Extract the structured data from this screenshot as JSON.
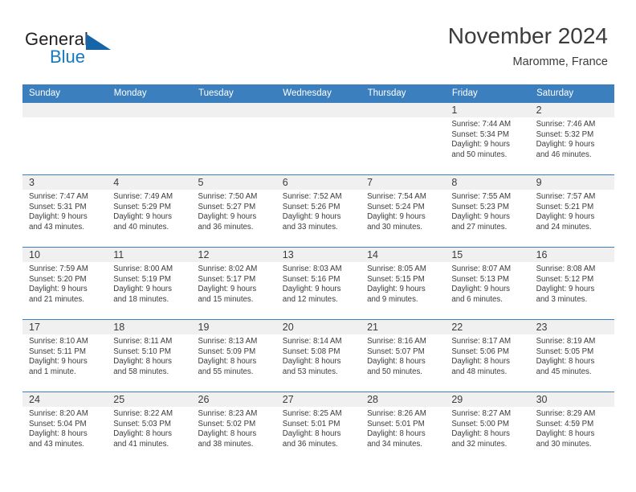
{
  "brand": {
    "word_one": "General",
    "word_two": "Blue",
    "triangle_icon": "triangle-logo-icon",
    "color_text": "#231f20",
    "color_blue": "#1878be"
  },
  "header": {
    "title": "November 2024",
    "subtitle": "Maromme, France"
  },
  "theme": {
    "header_blue": "#3c7fbe",
    "daynum_gray": "#f0f0f0",
    "text": "#3b3b3b"
  },
  "weekday_headers": [
    "Sunday",
    "Monday",
    "Tuesday",
    "Wednesday",
    "Thursday",
    "Friday",
    "Saturday"
  ],
  "labels": {
    "sunrise": "Sunrise:",
    "sunset": "Sunset:",
    "daylight": "Daylight:"
  },
  "weeks": [
    [
      {
        "day": "",
        "empty": true
      },
      {
        "day": "",
        "empty": true
      },
      {
        "day": "",
        "empty": true
      },
      {
        "day": "",
        "empty": true
      },
      {
        "day": "",
        "empty": true
      },
      {
        "day": "1",
        "sunrise": "Sunrise: 7:44 AM",
        "sunset": "Sunset: 5:34 PM",
        "daylight": "Daylight: 9 hours and 50 minutes."
      },
      {
        "day": "2",
        "sunrise": "Sunrise: 7:46 AM",
        "sunset": "Sunset: 5:32 PM",
        "daylight": "Daylight: 9 hours and 46 minutes."
      }
    ],
    [
      {
        "day": "3",
        "sunrise": "Sunrise: 7:47 AM",
        "sunset": "Sunset: 5:31 PM",
        "daylight": "Daylight: 9 hours and 43 minutes."
      },
      {
        "day": "4",
        "sunrise": "Sunrise: 7:49 AM",
        "sunset": "Sunset: 5:29 PM",
        "daylight": "Daylight: 9 hours and 40 minutes."
      },
      {
        "day": "5",
        "sunrise": "Sunrise: 7:50 AM",
        "sunset": "Sunset: 5:27 PM",
        "daylight": "Daylight: 9 hours and 36 minutes."
      },
      {
        "day": "6",
        "sunrise": "Sunrise: 7:52 AM",
        "sunset": "Sunset: 5:26 PM",
        "daylight": "Daylight: 9 hours and 33 minutes."
      },
      {
        "day": "7",
        "sunrise": "Sunrise: 7:54 AM",
        "sunset": "Sunset: 5:24 PM",
        "daylight": "Daylight: 9 hours and 30 minutes."
      },
      {
        "day": "8",
        "sunrise": "Sunrise: 7:55 AM",
        "sunset": "Sunset: 5:23 PM",
        "daylight": "Daylight: 9 hours and 27 minutes."
      },
      {
        "day": "9",
        "sunrise": "Sunrise: 7:57 AM",
        "sunset": "Sunset: 5:21 PM",
        "daylight": "Daylight: 9 hours and 24 minutes."
      }
    ],
    [
      {
        "day": "10",
        "sunrise": "Sunrise: 7:59 AM",
        "sunset": "Sunset: 5:20 PM",
        "daylight": "Daylight: 9 hours and 21 minutes."
      },
      {
        "day": "11",
        "sunrise": "Sunrise: 8:00 AM",
        "sunset": "Sunset: 5:19 PM",
        "daylight": "Daylight: 9 hours and 18 minutes."
      },
      {
        "day": "12",
        "sunrise": "Sunrise: 8:02 AM",
        "sunset": "Sunset: 5:17 PM",
        "daylight": "Daylight: 9 hours and 15 minutes."
      },
      {
        "day": "13",
        "sunrise": "Sunrise: 8:03 AM",
        "sunset": "Sunset: 5:16 PM",
        "daylight": "Daylight: 9 hours and 12 minutes."
      },
      {
        "day": "14",
        "sunrise": "Sunrise: 8:05 AM",
        "sunset": "Sunset: 5:15 PM",
        "daylight": "Daylight: 9 hours and 9 minutes."
      },
      {
        "day": "15",
        "sunrise": "Sunrise: 8:07 AM",
        "sunset": "Sunset: 5:13 PM",
        "daylight": "Daylight: 9 hours and 6 minutes."
      },
      {
        "day": "16",
        "sunrise": "Sunrise: 8:08 AM",
        "sunset": "Sunset: 5:12 PM",
        "daylight": "Daylight: 9 hours and 3 minutes."
      }
    ],
    [
      {
        "day": "17",
        "sunrise": "Sunrise: 8:10 AM",
        "sunset": "Sunset: 5:11 PM",
        "daylight": "Daylight: 9 hours and 1 minute."
      },
      {
        "day": "18",
        "sunrise": "Sunrise: 8:11 AM",
        "sunset": "Sunset: 5:10 PM",
        "daylight": "Daylight: 8 hours and 58 minutes."
      },
      {
        "day": "19",
        "sunrise": "Sunrise: 8:13 AM",
        "sunset": "Sunset: 5:09 PM",
        "daylight": "Daylight: 8 hours and 55 minutes."
      },
      {
        "day": "20",
        "sunrise": "Sunrise: 8:14 AM",
        "sunset": "Sunset: 5:08 PM",
        "daylight": "Daylight: 8 hours and 53 minutes."
      },
      {
        "day": "21",
        "sunrise": "Sunrise: 8:16 AM",
        "sunset": "Sunset: 5:07 PM",
        "daylight": "Daylight: 8 hours and 50 minutes."
      },
      {
        "day": "22",
        "sunrise": "Sunrise: 8:17 AM",
        "sunset": "Sunset: 5:06 PM",
        "daylight": "Daylight: 8 hours and 48 minutes."
      },
      {
        "day": "23",
        "sunrise": "Sunrise: 8:19 AM",
        "sunset": "Sunset: 5:05 PM",
        "daylight": "Daylight: 8 hours and 45 minutes."
      }
    ],
    [
      {
        "day": "24",
        "sunrise": "Sunrise: 8:20 AM",
        "sunset": "Sunset: 5:04 PM",
        "daylight": "Daylight: 8 hours and 43 minutes."
      },
      {
        "day": "25",
        "sunrise": "Sunrise: 8:22 AM",
        "sunset": "Sunset: 5:03 PM",
        "daylight": "Daylight: 8 hours and 41 minutes."
      },
      {
        "day": "26",
        "sunrise": "Sunrise: 8:23 AM",
        "sunset": "Sunset: 5:02 PM",
        "daylight": "Daylight: 8 hours and 38 minutes."
      },
      {
        "day": "27",
        "sunrise": "Sunrise: 8:25 AM",
        "sunset": "Sunset: 5:01 PM",
        "daylight": "Daylight: 8 hours and 36 minutes."
      },
      {
        "day": "28",
        "sunrise": "Sunrise: 8:26 AM",
        "sunset": "Sunset: 5:01 PM",
        "daylight": "Daylight: 8 hours and 34 minutes."
      },
      {
        "day": "29",
        "sunrise": "Sunrise: 8:27 AM",
        "sunset": "Sunset: 5:00 PM",
        "daylight": "Daylight: 8 hours and 32 minutes."
      },
      {
        "day": "30",
        "sunrise": "Sunrise: 8:29 AM",
        "sunset": "Sunset: 4:59 PM",
        "daylight": "Daylight: 8 hours and 30 minutes."
      }
    ]
  ]
}
